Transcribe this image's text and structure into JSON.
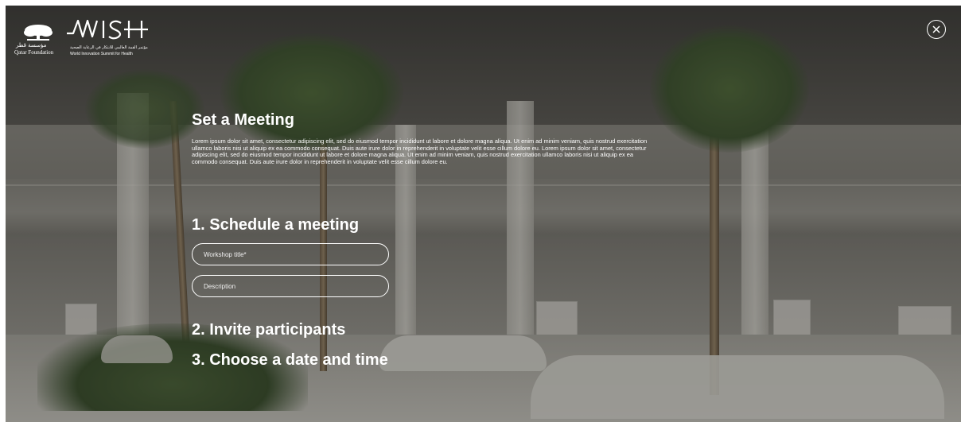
{
  "header": {
    "qf_logo": {
      "arabic": "مؤسسة قطر",
      "name": "Qatar Foundation"
    },
    "wish_logo": {
      "mark": "WISH",
      "arabic": "مؤتمر القمة العالمي للابتكار في الرعاية الصحية",
      "name": "World Innovation Summit for Health"
    },
    "close_icon": "close-icon"
  },
  "meeting": {
    "title": "Set a Meeting",
    "intro": "Lorem ipsum dolor sit amet, consectetur adipiscing elit, sed do eiusmod tempor incididunt ut labore et dolore magna aliqua. Ut enim ad minim veniam, quis nostrud exercitation ullamco laboris nisi ut aliquip ex ea commodo consequat. Duis aute irure dolor in reprehenderit in voluptate velit esse cillum dolore eu. Lorem ipsum dolor sit amet, consectetur adipiscing elit, sed do eiusmod tempor incididunt ut labore et dolore magna aliqua. Ut enim ad minim veniam, quis nostrud exercitation ullamco laboris nisi ut aliquip ex ea commodo consequat. Duis aute irure dolor in reprehenderit in voluptate velit esse cillum dolore eu.",
    "step1": {
      "heading": "1. Schedule a meeting",
      "workshop_placeholder": "Workshop title*",
      "description_placeholder": "Description"
    },
    "step2": {
      "heading": "2. Invite participants"
    },
    "step3": {
      "heading": "3. Choose a date and time"
    }
  },
  "colors": {
    "text": "#ffffff",
    "overlay": "rgba(20,20,18,0.32)"
  }
}
